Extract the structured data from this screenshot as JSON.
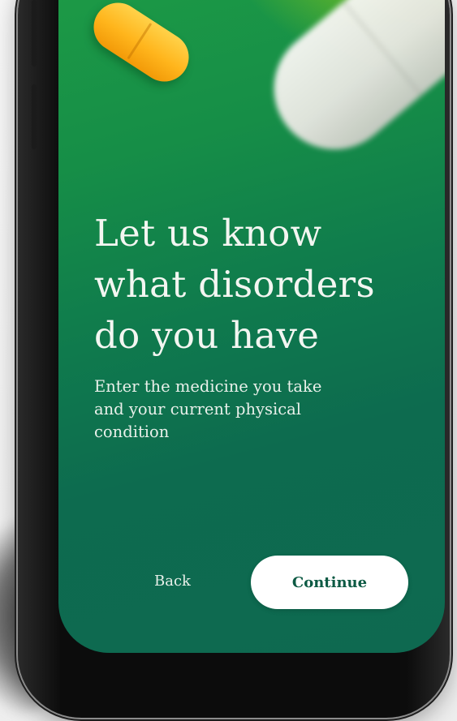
{
  "onboarding": {
    "headline_lines": [
      "Let us know",
      "what disorders",
      "do you have"
    ],
    "subtitle_lines": [
      "Enter the medicine you take",
      "and your current physical",
      "condition"
    ]
  },
  "actions": {
    "back_label": "Back",
    "continue_label": "Continue"
  },
  "colors": {
    "background_top": "#1f9e46",
    "background_bottom": "#0d6b4f",
    "accent_glow": "#bee100",
    "continue_text": "#0d5a44",
    "continue_bg": "#ffffff"
  }
}
